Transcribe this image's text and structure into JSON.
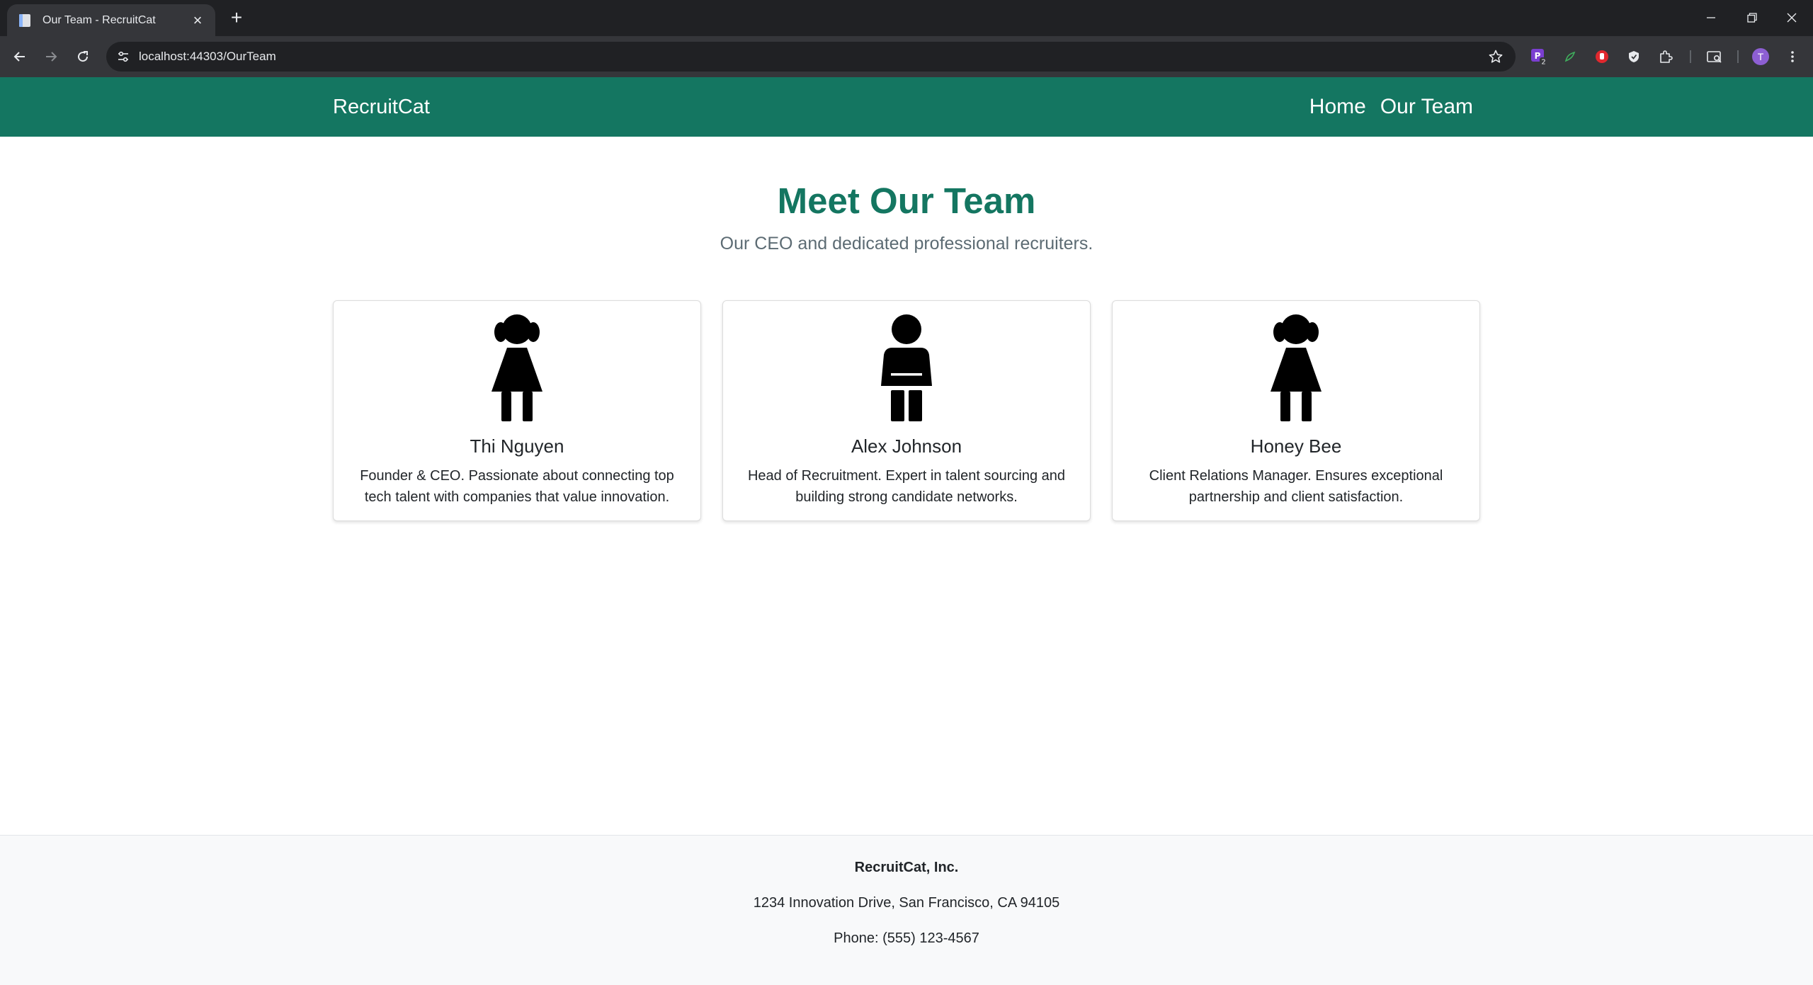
{
  "browser": {
    "tab_title": "Our Team - RecruitCat",
    "url": "localhost:44303/OurTeam",
    "profile_initial": "T",
    "extension_badge": "2",
    "extension_letter": "P"
  },
  "navbar": {
    "brand": "RecruitCat",
    "links": [
      {
        "label": "Home"
      },
      {
        "label": "Our Team"
      }
    ],
    "color": "#147661"
  },
  "hero": {
    "title": "Meet Our Team",
    "subtitle": "Our CEO and dedicated professional recruiters."
  },
  "team": [
    {
      "name": "Thi Nguyen",
      "icon": "person-dress-icon",
      "description": "Founder & CEO. Passionate about connecting top tech talent with companies that value innovation."
    },
    {
      "name": "Alex Johnson",
      "icon": "child-icon",
      "description": "Head of Recruitment. Expert in talent sourcing and building strong candidate networks."
    },
    {
      "name": "Honey Bee",
      "icon": "person-dress-icon",
      "description": "Client Relations Manager. Ensures exceptional partnership and client satisfaction."
    }
  ],
  "footer": {
    "company": "RecruitCat, Inc.",
    "address": "1234 Innovation Drive, San Francisco, CA 94105",
    "phone": "Phone: (555) 123-4567"
  }
}
